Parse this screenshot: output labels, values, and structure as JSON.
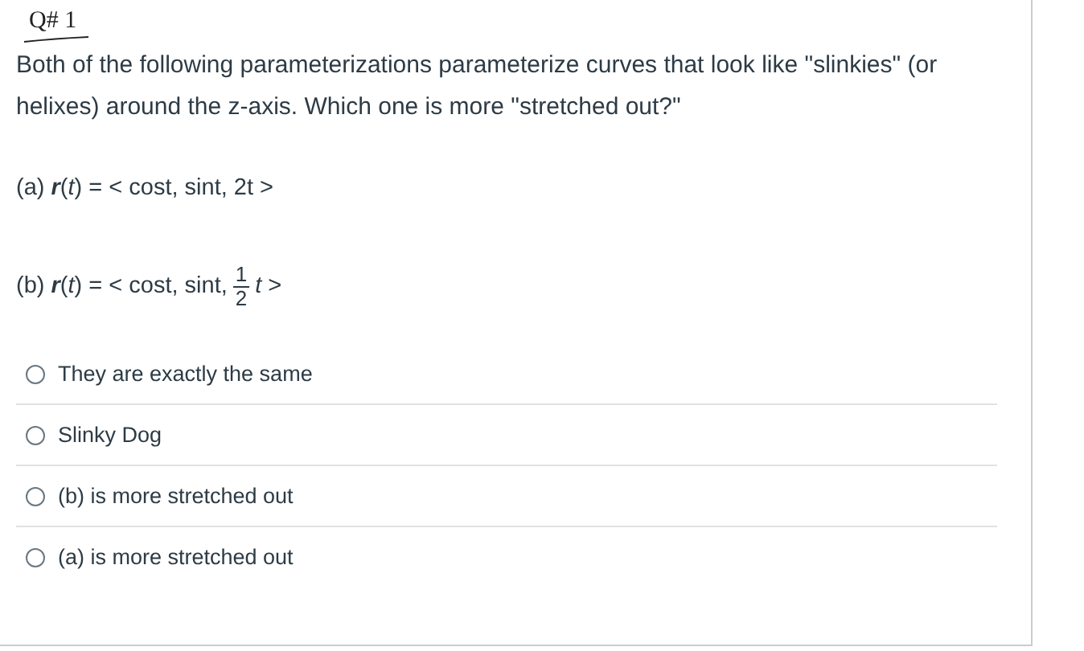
{
  "question": {
    "number": "Q# 1",
    "text": "Both of the following parameterizations parameterize curves that look like \"slinkies\" (or helixes) around the z-axis. Which one is more \"stretched out?\"",
    "formulas": [
      {
        "kind": "plain",
        "text": "(a) **r**(*t*) = < cost, sint, 2t >"
      },
      {
        "kind": "fraction",
        "prefix": "(b) **r**(*t*) = < cost, sint,",
        "numerator": "1",
        "denominator": "2",
        "suffix": "*t* >"
      }
    ],
    "options": [
      {
        "label": "They are exactly the same",
        "selected": false
      },
      {
        "label": "Slinky Dog",
        "selected": false
      },
      {
        "label": "(b) is more stretched out",
        "selected": false
      },
      {
        "label": "(a) is more stretched out",
        "selected": false
      }
    ]
  }
}
